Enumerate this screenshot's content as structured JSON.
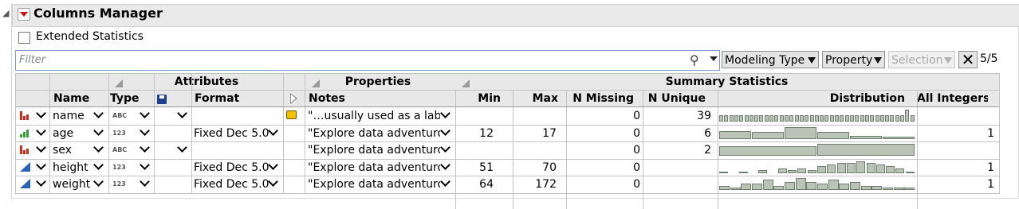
{
  "panel": {
    "title": "Columns Manager",
    "extended_statistics_label": "Extended Statistics"
  },
  "filter": {
    "placeholder": "Filter"
  },
  "toolbar": {
    "modeling_type_label": "Modeling Type",
    "property_label": "Property",
    "selection_label": "Selection",
    "count_label": "5/5"
  },
  "groups": {
    "attributes": "Attributes",
    "properties": "Properties",
    "summary": "Summary Statistics"
  },
  "columns": {
    "name": "Name",
    "type": "Type",
    "format": "Format",
    "notes": "Notes",
    "min": "Min",
    "max": "Max",
    "n_missing": "N Missing",
    "n_unique": "N Unique",
    "distribution": "Distribution",
    "all_integers": "All Integers"
  },
  "rows": [
    {
      "modeling": "nominal",
      "name": "name",
      "type": "ABC",
      "format": "",
      "notes": "\"…usually used as a label",
      "has_note_icon": true,
      "min": "",
      "max": "",
      "n_missing": "0",
      "n_unique": "39",
      "all_integers": "",
      "dist": [
        1,
        1,
        1,
        1,
        1,
        1,
        1,
        1,
        1,
        1,
        1,
        1,
        1,
        1,
        1,
        1,
        1,
        1,
        1,
        1,
        1,
        1,
        1,
        1,
        1,
        1,
        1,
        1,
        1,
        1,
        1,
        1,
        1,
        1,
        1,
        1,
        1,
        2,
        1
      ]
    },
    {
      "modeling": "ordinal",
      "name": "age",
      "type": "123",
      "format": "Fixed Dec 5.0",
      "notes": "\"Explore data adventurou",
      "has_note_icon": false,
      "min": "12",
      "max": "17",
      "n_missing": "0",
      "n_unique": "6",
      "all_integers": "1",
      "dist": [
        8,
        7,
        12,
        7,
        3,
        2
      ]
    },
    {
      "modeling": "nominal",
      "name": "sex",
      "type": "ABC",
      "format": "",
      "notes": "\"Explore data adventurou",
      "has_note_icon": false,
      "min": "",
      "max": "",
      "n_missing": "0",
      "n_unique": "2",
      "all_integers": "",
      "dist": [
        18,
        22
      ]
    },
    {
      "modeling": "continuous",
      "name": "height",
      "type": "123",
      "format": "Fixed Dec 5.0",
      "notes": "\"Explore data adventurou",
      "has_note_icon": false,
      "min": "51",
      "max": "70",
      "n_missing": "0",
      "n_unique": "",
      "all_integers": "1",
      "dist": [
        1,
        0,
        1,
        0,
        2,
        0,
        3,
        2,
        3,
        2,
        4,
        5,
        6,
        6,
        7,
        6,
        5,
        4,
        3,
        1
      ]
    },
    {
      "modeling": "continuous",
      "name": "weight",
      "type": "123",
      "format": "Fixed Dec 5.0",
      "notes": "\"Explore data adventurou",
      "has_note_icon": false,
      "min": "64",
      "max": "172",
      "n_missing": "0",
      "n_unique": "",
      "all_integers": "1",
      "dist": [
        2,
        1,
        3,
        3,
        5,
        2,
        4,
        6,
        4,
        3,
        5,
        3,
        4,
        2,
        2,
        1,
        1,
        1
      ]
    }
  ],
  "colors": {
    "nominal": "#d42a1c",
    "ordinal": "#3aa03a",
    "continuous": "#2c5fb8",
    "dist_bar": "#b9c4b7",
    "dist_stroke": "#6f7f6d"
  }
}
